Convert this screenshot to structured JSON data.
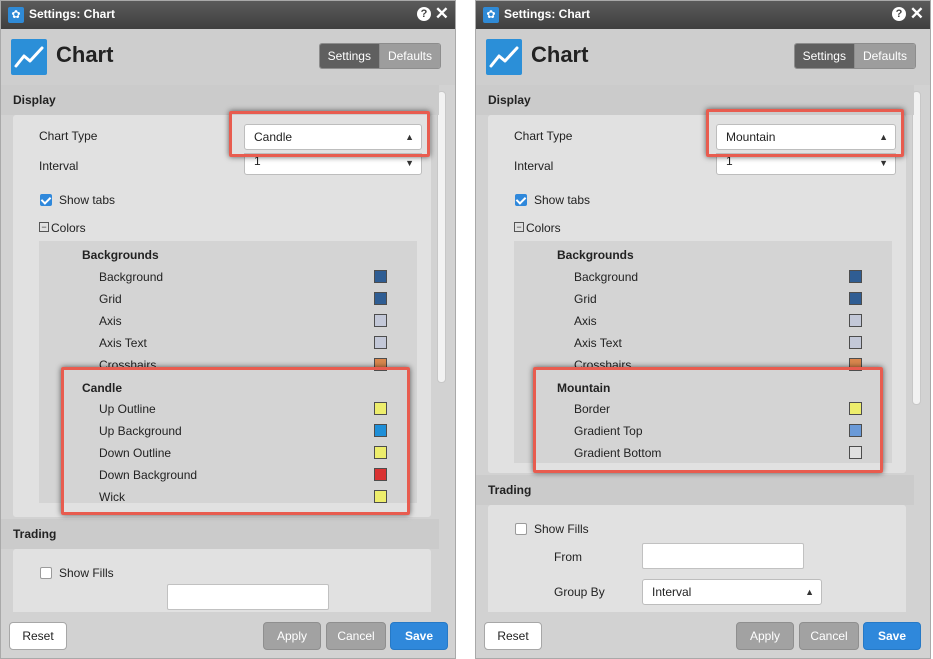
{
  "left": {
    "title": "Settings: Chart",
    "header_title": "Chart",
    "tabs": [
      "Settings",
      "Defaults"
    ],
    "display": {
      "section_label": "Display",
      "chart_type_label": "Chart Type",
      "chart_type_value": "Candle",
      "interval_label": "Interval",
      "interval_value": "1",
      "show_tabs_label": "Show tabs",
      "show_tabs_checked": true,
      "colors_label": "Colors"
    },
    "backgrounds": {
      "title": "Backgrounds",
      "items": [
        {
          "label": "Background",
          "color": "#2f5d93"
        },
        {
          "label": "Grid",
          "color": "#2f5d93"
        },
        {
          "label": "Axis",
          "color": "#c3c8d8"
        },
        {
          "label": "Axis Text",
          "color": "#c3c8d8"
        },
        {
          "label": "Crosshairs",
          "color": "#d9874d"
        }
      ]
    },
    "series_group": {
      "title": "Candle",
      "items": [
        {
          "label": "Up Outline",
          "color": "#eded6c"
        },
        {
          "label": "Up Background",
          "color": "#1e8fd8"
        },
        {
          "label": "Down Outline",
          "color": "#eded6c"
        },
        {
          "label": "Down Background",
          "color": "#d93232"
        },
        {
          "label": "Wick",
          "color": "#eded6c"
        }
      ]
    },
    "trading": {
      "section_label": "Trading",
      "show_fills_label": "Show Fills"
    },
    "footer": {
      "reset": "Reset",
      "apply": "Apply",
      "cancel": "Cancel",
      "save": "Save"
    }
  },
  "right": {
    "title": "Settings: Chart",
    "header_title": "Chart",
    "tabs": [
      "Settings",
      "Defaults"
    ],
    "display": {
      "section_label": "Display",
      "chart_type_label": "Chart Type",
      "chart_type_value": "Mountain",
      "interval_label": "Interval",
      "interval_value": "1",
      "show_tabs_label": "Show tabs",
      "show_tabs_checked": true,
      "colors_label": "Colors"
    },
    "backgrounds": {
      "title": "Backgrounds",
      "items": [
        {
          "label": "Background",
          "color": "#2f5d93"
        },
        {
          "label": "Grid",
          "color": "#2f5d93"
        },
        {
          "label": "Axis",
          "color": "#c3c8d8"
        },
        {
          "label": "Axis Text",
          "color": "#c3c8d8"
        },
        {
          "label": "Crosshairs",
          "color": "#d9874d"
        }
      ]
    },
    "series_group": {
      "title": "Mountain",
      "items": [
        {
          "label": "Border",
          "color": "#eded6c"
        },
        {
          "label": "Gradient Top",
          "color": "#6a9ad8"
        },
        {
          "label": "Gradient Bottom",
          "color": "#e0e0e0"
        }
      ]
    },
    "trading": {
      "section_label": "Trading",
      "show_fills_label": "Show Fills",
      "from_label": "From",
      "from_value": "",
      "group_by_label": "Group By",
      "group_by_value": "Interval"
    },
    "footer": {
      "reset": "Reset",
      "apply": "Apply",
      "cancel": "Cancel",
      "save": "Save"
    }
  }
}
